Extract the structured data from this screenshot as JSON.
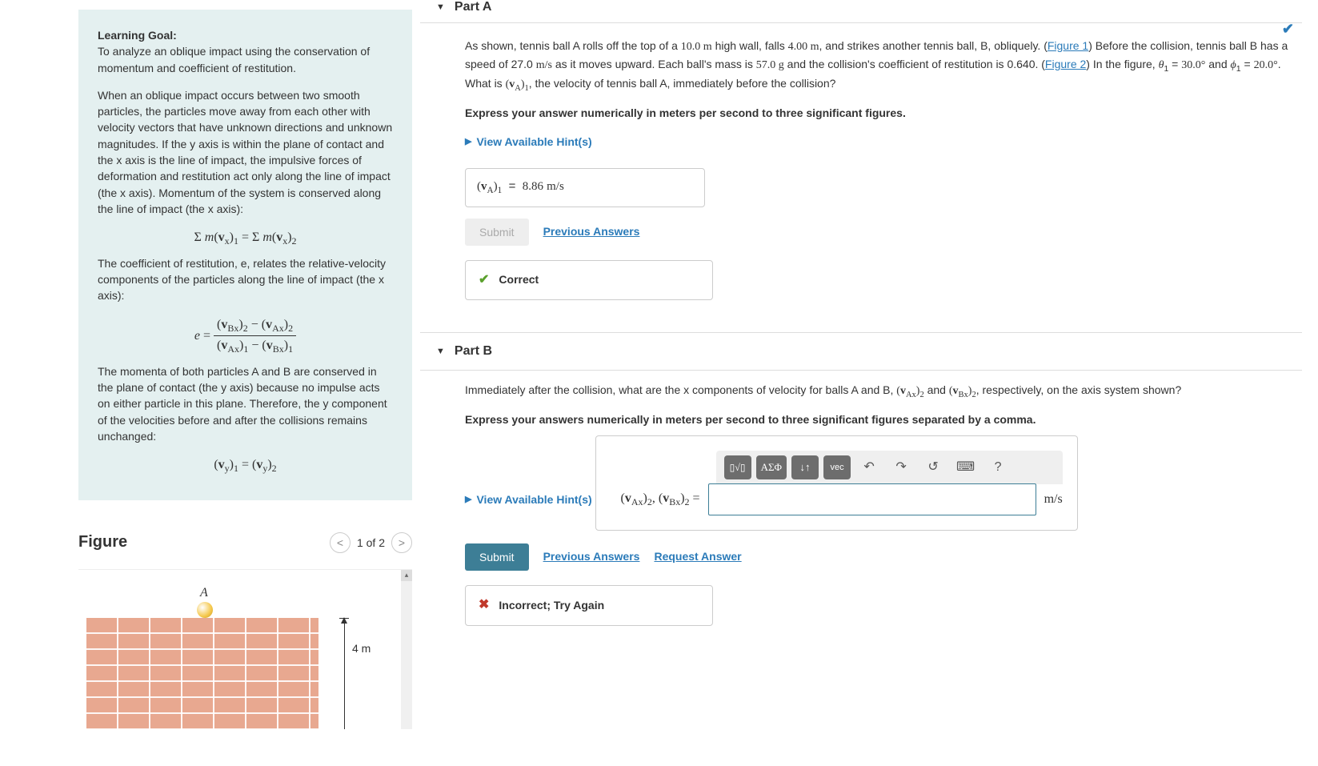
{
  "learning": {
    "title": "Learning Goal:",
    "goal": "To analyze an oblique impact using the conservation of momentum and coefficient of restitution.",
    "p1": "When an oblique impact occurs between two smooth particles, the particles move away from each other with velocity vectors that have unknown directions and unknown magnitudes.  If the y axis is within the plane of contact and the x axis is the line of impact, the impulsive forces of deformation and restitution act only along the line of impact (the x axis).  Momentum of the system is conserved along the line of impact (the x axis):",
    "eq1": "Σ m(vₓ)₁ = Σ m(vₓ)₂",
    "p2": "The coefficient of restitution, e, relates the relative-velocity components of the particles along the line of impact (the x axis):",
    "eq2_lhs": "e =",
    "eq2_num": "(v_Bx)₂ − (v_Ax)₂",
    "eq2_den": "(v_Ax)₁ − (v_Bx)₁",
    "p3": "The momenta of both particles A and B are conserved in the plane of contact (the y axis) because no impulse acts on either particle in this plane. Therefore, the y component of the velocities before and after the collisions remains unchanged:",
    "eq3": "(v_y)₁ = (v_y)₂"
  },
  "figure": {
    "title": "Figure",
    "pager": "1 of 2",
    "ball_label": "A",
    "dim": "4 m"
  },
  "partA": {
    "header": "Part A",
    "text_1": "As shown, tennis ball A rolls off the top of a ",
    "h": "10.0 m",
    "text_2": " high wall, falls ",
    "fall": "4.00 m",
    "text_3": ", and strikes another tennis ball, B, obliquely. (",
    "fig1": "Figure 1",
    "text_4": ") Before the collision, tennis ball B has a speed of 27.0 ",
    "units_v": "m/s",
    "text_5": " as it moves upward. Each ball's mass is ",
    "mass": "57.0 g",
    "text_6": " and the collision's coefficient of restitution is 0.640. (",
    "fig2": "Figure 2",
    "text_7": ") In the figure, ",
    "theta": "θ₁ = 30.0°",
    "and": " and ",
    "phi": "ϕ₁ = 20.0°",
    "text_8": ".  What is ",
    "va1": "(v_A)₁",
    "text_9": ", the velocity of tennis ball A, immediately before the collision?",
    "express": "Express your answer numerically in meters per second to three significant figures.",
    "hints": "View Available Hint(s)",
    "ans_label": "(v_A)₁ = ",
    "ans_value": "8.86",
    "ans_unit": " m/s",
    "submit": "Submit",
    "prev": "Previous Answers",
    "correct": "Correct"
  },
  "partB": {
    "header": "Part B",
    "text": "Immediately after the collision, what are the x components of velocity for balls A and B, ",
    "vax2": "(v_Ax)₂",
    "and": " and ",
    "vbx2": "(v_Bx)₂",
    "text2": ", respectively, on the axis system shown?",
    "express": "Express your answers numerically in meters per second to three significant figures separated by a comma.",
    "hints": "View Available Hint(s)",
    "tool_templates": "▯√▯",
    "tool_greek": "ΑΣΦ",
    "tool_updown": "↓↑",
    "tool_vec": "vec",
    "tool_undo": "↶",
    "tool_redo": "↷",
    "tool_reset": "↺",
    "tool_keyboard": "⌨",
    "tool_help": "?",
    "eq_label": "(v_Ax)₂, (v_Bx)₂ =",
    "unit": "m/s",
    "submit": "Submit",
    "prev": "Previous Answers",
    "req": "Request Answer",
    "feedback": "Incorrect; Try Again"
  }
}
